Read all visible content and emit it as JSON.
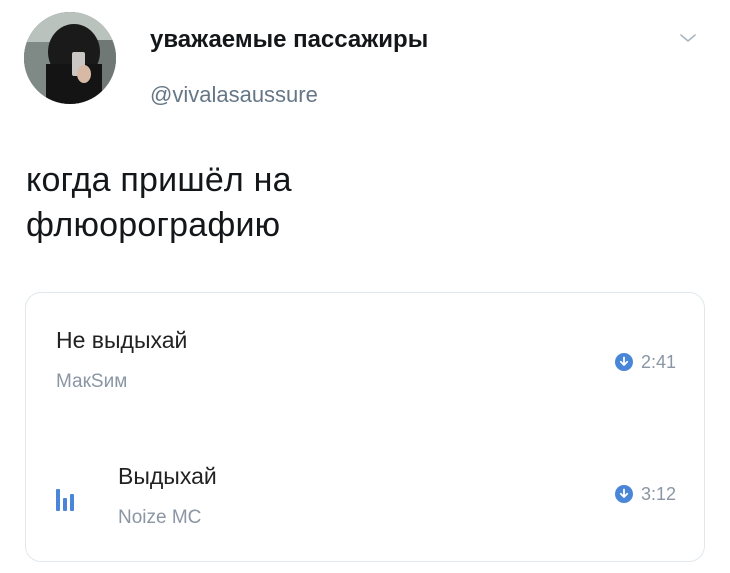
{
  "tweet": {
    "author_name": "уважаемые пассажиры",
    "author_handle": "@vivalasaussure",
    "text": "когда пришёл на\nфлюорографию",
    "menu_icon": "chevron-down-icon"
  },
  "audio_card": {
    "tracks": [
      {
        "title": "Не выдыхай",
        "artist": "МакSим",
        "duration": "2:41",
        "download_icon": "download-icon",
        "playing": false
      },
      {
        "title": "Выдыхай",
        "artist": "Noize MC",
        "duration": "3:12",
        "download_icon": "download-icon",
        "playing": true,
        "playing_icon": "equalizer-icon"
      }
    ]
  },
  "colors": {
    "accent": "#4a86d8",
    "secondary_text": "#657786",
    "muted_text": "#8a96a3",
    "card_border": "#e1e8ed"
  }
}
